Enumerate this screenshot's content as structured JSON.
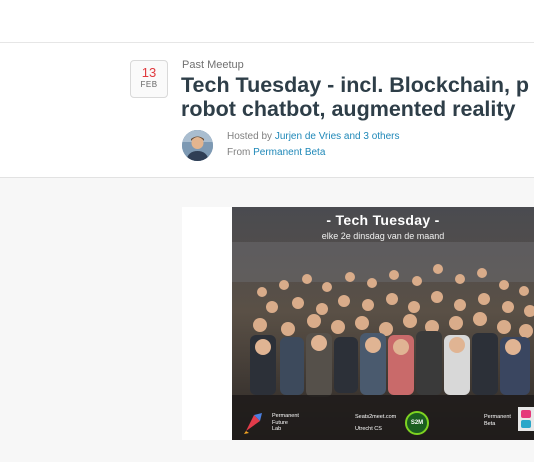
{
  "event": {
    "status_label": "Past Meetup",
    "date": {
      "day": "13",
      "month": "FEB"
    },
    "title_line1": "Tech Tuesday - incl. Blockchain, p",
    "title_line2": "robot chatbot, augmented reality",
    "hosted_prefix": "Hosted by",
    "hosts_link": "Jurjen de Vries and 3 others",
    "from_prefix": "From",
    "group_link": "Permanent Beta"
  },
  "photo": {
    "title": "- Tech Tuesday -",
    "subtitle": "elke 2e dinsdag van de maand",
    "logo_left": [
      "Permanent",
      "Future",
      "Lab"
    ],
    "logo_center": [
      "Seats2meet.com",
      "Utrecht CS"
    ],
    "logo_center_badge": "S2M",
    "logo_right": [
      "Permanent",
      "Beta"
    ]
  },
  "colors": {
    "title": "#2e3e48",
    "link": "#1f88b8",
    "date_day": "#e0393e"
  }
}
